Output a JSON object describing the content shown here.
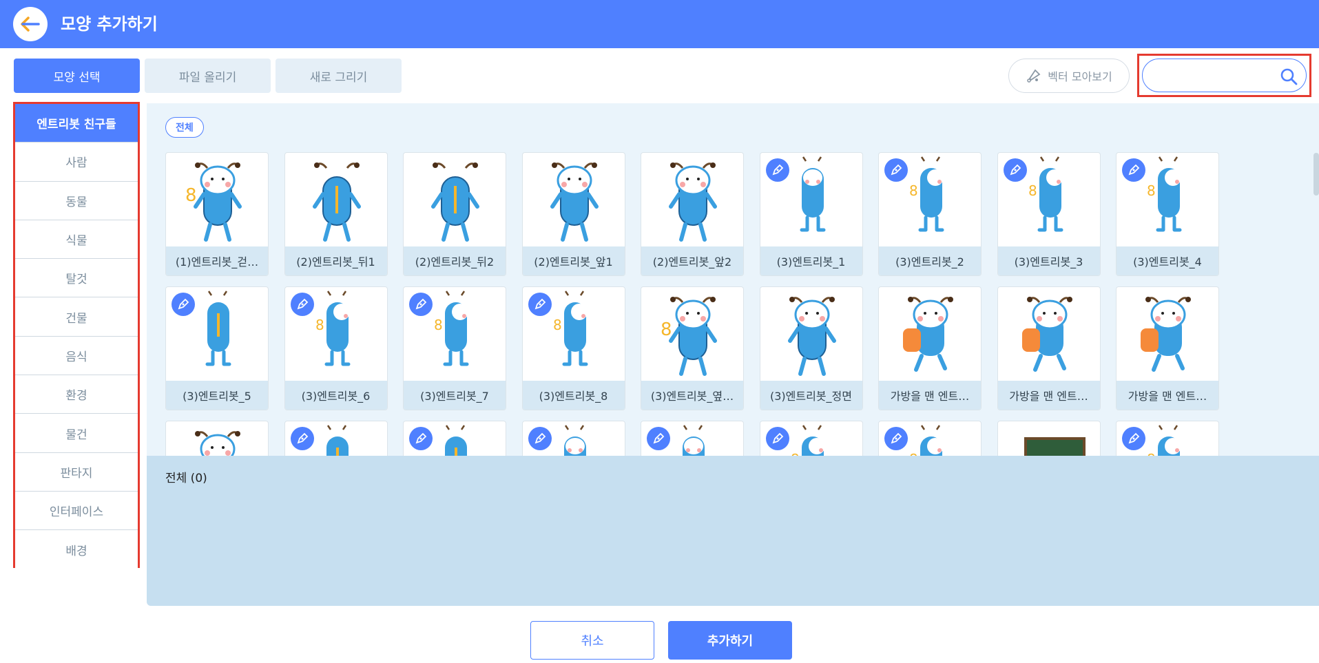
{
  "header": {
    "title": "모양 추가하기"
  },
  "tabs": [
    {
      "label": "모양 선택",
      "active": true
    },
    {
      "label": "파일 올리기",
      "active": false
    },
    {
      "label": "새로 그리기",
      "active": false
    }
  ],
  "vector_button": {
    "label": "벡터 모아보기"
  },
  "search": {
    "value": "",
    "placeholder": ""
  },
  "sidebar": {
    "items": [
      {
        "label": "엔트리봇 친구들",
        "active": true
      },
      {
        "label": "사람"
      },
      {
        "label": "동물"
      },
      {
        "label": "식물"
      },
      {
        "label": "탈것"
      },
      {
        "label": "건물"
      },
      {
        "label": "음식"
      },
      {
        "label": "환경"
      },
      {
        "label": "물건"
      },
      {
        "label": "판타지"
      },
      {
        "label": "인터페이스"
      },
      {
        "label": "배경"
      }
    ]
  },
  "filter_chip": {
    "label": "전체"
  },
  "items": [
    {
      "label": "(1)엔트리봇_걷…",
      "vector": false,
      "pose": "walk"
    },
    {
      "label": "(2)엔트리봇_뒤1",
      "vector": false,
      "pose": "back"
    },
    {
      "label": "(2)엔트리봇_뒤2",
      "vector": false,
      "pose": "back"
    },
    {
      "label": "(2)엔트리봇_앞1",
      "vector": false,
      "pose": "front"
    },
    {
      "label": "(2)엔트리봇_앞2",
      "vector": false,
      "pose": "front"
    },
    {
      "label": "(3)엔트리봇_1",
      "vector": true,
      "pose": "simple-front"
    },
    {
      "label": "(3)엔트리봇_2",
      "vector": true,
      "pose": "simple-side"
    },
    {
      "label": "(3)엔트리봇_3",
      "vector": true,
      "pose": "simple-side"
    },
    {
      "label": "(3)엔트리봇_4",
      "vector": true,
      "pose": "simple-side"
    },
    {
      "label": "(3)엔트리봇_5",
      "vector": true,
      "pose": "simple-back"
    },
    {
      "label": "(3)엔트리봇_6",
      "vector": true,
      "pose": "simple-side"
    },
    {
      "label": "(3)엔트리봇_7",
      "vector": true,
      "pose": "simple-side"
    },
    {
      "label": "(3)엔트리봇_8",
      "vector": true,
      "pose": "simple-side"
    },
    {
      "label": "(3)엔트리봇_옆…",
      "vector": false,
      "pose": "side"
    },
    {
      "label": "(3)엔트리봇_정면",
      "vector": false,
      "pose": "front"
    },
    {
      "label": "가방을 맨 엔트…",
      "vector": false,
      "pose": "backpack"
    },
    {
      "label": "가방을 맨 엔트…",
      "vector": false,
      "pose": "backpack"
    },
    {
      "label": "가방을 맨 엔트…",
      "vector": false,
      "pose": "backpack"
    },
    {
      "label": "",
      "vector": false,
      "pose": "walk"
    },
    {
      "label": "",
      "vector": true,
      "pose": "simple-back"
    },
    {
      "label": "",
      "vector": true,
      "pose": "simple-back"
    },
    {
      "label": "",
      "vector": true,
      "pose": "simple-front"
    },
    {
      "label": "",
      "vector": true,
      "pose": "simple-front"
    },
    {
      "label": "",
      "vector": true,
      "pose": "simple-side"
    },
    {
      "label": "",
      "vector": true,
      "pose": "simple-side"
    },
    {
      "label": "",
      "vector": false,
      "pose": "board"
    },
    {
      "label": "",
      "vector": true,
      "pose": "simple-side"
    }
  ],
  "selected_panel": {
    "title": "전체 (0)"
  },
  "footer": {
    "cancel_label": "취소",
    "add_label": "추가하기"
  },
  "colors": {
    "primary": "#4f80ff",
    "highlight_border": "#e53a2f",
    "robot_blue": "#3a9fe0"
  }
}
